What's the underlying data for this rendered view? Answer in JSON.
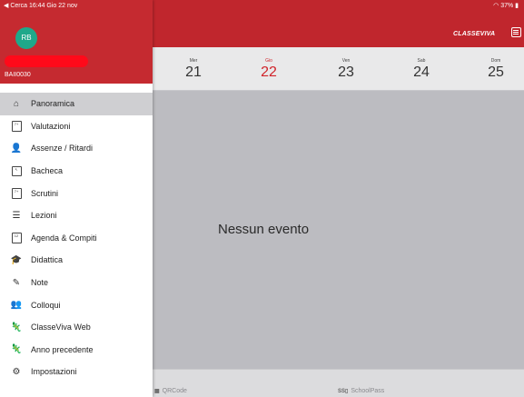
{
  "status": {
    "left": "◀ Cerca  16:44  Gio 22 nov",
    "right": "37%"
  },
  "brand": "CLASSEVIVA",
  "drawer": {
    "avatar_initials": "RB",
    "user_code": "BAII0030",
    "menu": [
      {
        "label": "Panoramica",
        "icon": "home-icon",
        "active": true
      },
      {
        "label": "Valutazioni",
        "icon": "grades-icon"
      },
      {
        "label": "Assenze / Ritardi",
        "icon": "absences-icon"
      },
      {
        "label": "Bacheca",
        "icon": "board-icon"
      },
      {
        "label": "Scrutini",
        "icon": "report-icon"
      },
      {
        "label": "Lezioni",
        "icon": "lessons-icon"
      },
      {
        "label": "Agenda & Compiti",
        "icon": "calendar-icon"
      },
      {
        "label": "Didattica",
        "icon": "graduation-cap-icon"
      },
      {
        "label": "Note",
        "icon": "note-icon"
      },
      {
        "label": "Colloqui",
        "icon": "people-icon"
      },
      {
        "label": "ClasseViva Web",
        "icon": "web-icon"
      },
      {
        "label": "Anno precedente",
        "icon": "previous-year-icon"
      },
      {
        "label": "Impostazioni",
        "icon": "settings-icon"
      }
    ]
  },
  "week": [
    {
      "name": "Mer",
      "num": "21"
    },
    {
      "name": "Gio",
      "num": "22",
      "active": true
    },
    {
      "name": "Ven",
      "num": "23"
    },
    {
      "name": "Sab",
      "num": "24"
    },
    {
      "name": "Dom",
      "num": "25"
    }
  ],
  "main": {
    "empty_message": "Nessun evento"
  },
  "bottom": {
    "qrcode_label": "QRCode",
    "schoolpass_label": "SchoolPass"
  },
  "colors": {
    "brand_red": "#c0262d",
    "active_day": "#d0232a",
    "avatar": "#1fa88a"
  }
}
